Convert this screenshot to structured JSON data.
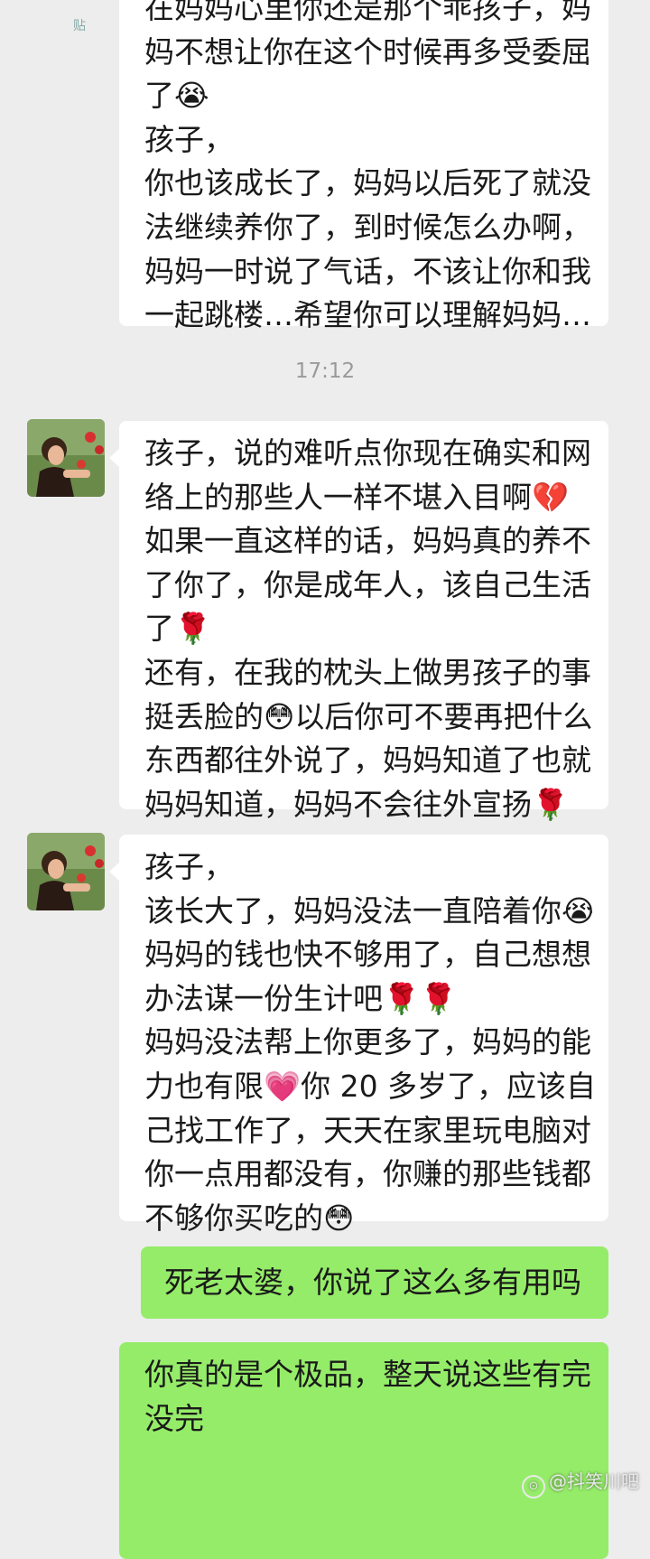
{
  "status_overlay_label": "贴",
  "messages": [
    {
      "type": "incoming",
      "lines": [
        "在妈妈心里你还是那个乖孩子，妈",
        "妈不想让你在这个时候再多受委屈",
        "了😭",
        "孩子，",
        "你也该成长了，妈妈以后死了就没",
        "法继续养你了，到时候怎么办啊，",
        "妈妈一时说了气话，不该让你和我",
        "一起跳楼…希望你可以理解妈妈…"
      ]
    },
    {
      "type": "timestamp",
      "text": "17:12"
    },
    {
      "type": "incoming",
      "lines": [
        "孩子，说的难听点你现在确实和网",
        "络上的那些人一样不堪入目啊💔",
        "如果一直这样的话，妈妈真的养不",
        "了你了，你是成年人，该自己生活",
        "了🌹",
        "还有，在我的枕头上做男孩子的事",
        "挺丢脸的😳以后你可不要再把什么",
        "东西都往外说了，妈妈知道了也就",
        "妈妈知道，妈妈不会往外宣扬🌹"
      ]
    },
    {
      "type": "incoming",
      "lines": [
        "孩子，",
        "该长大了，妈妈没法一直陪着你😭",
        "妈妈的钱也快不够用了，自己想想",
        "办法谋一份生计吧🌹🌹",
        "妈妈没法帮上你更多了，妈妈的能",
        "力也有限💗你 20 多岁了，应该自",
        "己找工作了，天天在家里玩电脑对",
        "你一点用都没有，你赚的那些钱都",
        "不够你买吃的😳"
      ]
    },
    {
      "type": "outgoing",
      "lines": [
        "死老太婆，你说了这么多有用吗"
      ]
    },
    {
      "type": "outgoing",
      "lines": [
        "你真的是个极品，整天说这些有完",
        "没完"
      ]
    }
  ],
  "watermark": {
    "icon": "tieba-icon",
    "text": "@抖笑川吧"
  },
  "colors": {
    "background": "#ededed",
    "incoming_bubble": "#ffffff",
    "outgoing_bubble": "#95ec69",
    "text": "#1a1a1a",
    "timestamp": "#9a9a9a"
  }
}
